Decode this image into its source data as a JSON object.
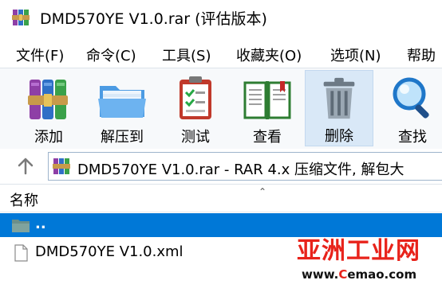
{
  "window": {
    "title": "DMD570YE V1.0.rar (评估版本)"
  },
  "menu": {
    "items": [
      {
        "label": "文件(F)"
      },
      {
        "label": "命令(C)"
      },
      {
        "label": "工具(S)"
      },
      {
        "label": "收藏夹(O)"
      },
      {
        "label": "选项(N)"
      },
      {
        "label": "帮助"
      }
    ]
  },
  "toolbar": {
    "buttons": [
      {
        "label": "添加",
        "icon": "add-archive-icon"
      },
      {
        "label": "解压到",
        "icon": "extract-folder-icon"
      },
      {
        "label": "测试",
        "icon": "test-clipboard-icon"
      },
      {
        "label": "查看",
        "icon": "view-book-icon"
      },
      {
        "label": "删除",
        "icon": "trash-icon",
        "active": true
      },
      {
        "label": "查找",
        "icon": "magnifier-icon"
      }
    ]
  },
  "address": {
    "text": "DMD570YE V1.0.rar - RAR 4.x 压缩文件, 解包大"
  },
  "list": {
    "column_name": "名称",
    "rows": [
      {
        "name": "..",
        "icon": "folder-icon",
        "selected": true
      },
      {
        "name": "DMD570YE V1.0.xml",
        "icon": "file-icon",
        "selected": false
      }
    ]
  },
  "watermark": {
    "big": "亚洲工业网",
    "small_prefix": "www.",
    "small_accent": "C",
    "small_suffix": "emao.com"
  },
  "colors": {
    "selection": "#0078d7",
    "watermark_red": "#e8231b",
    "toolbar_bg": "#f7f9fb"
  }
}
